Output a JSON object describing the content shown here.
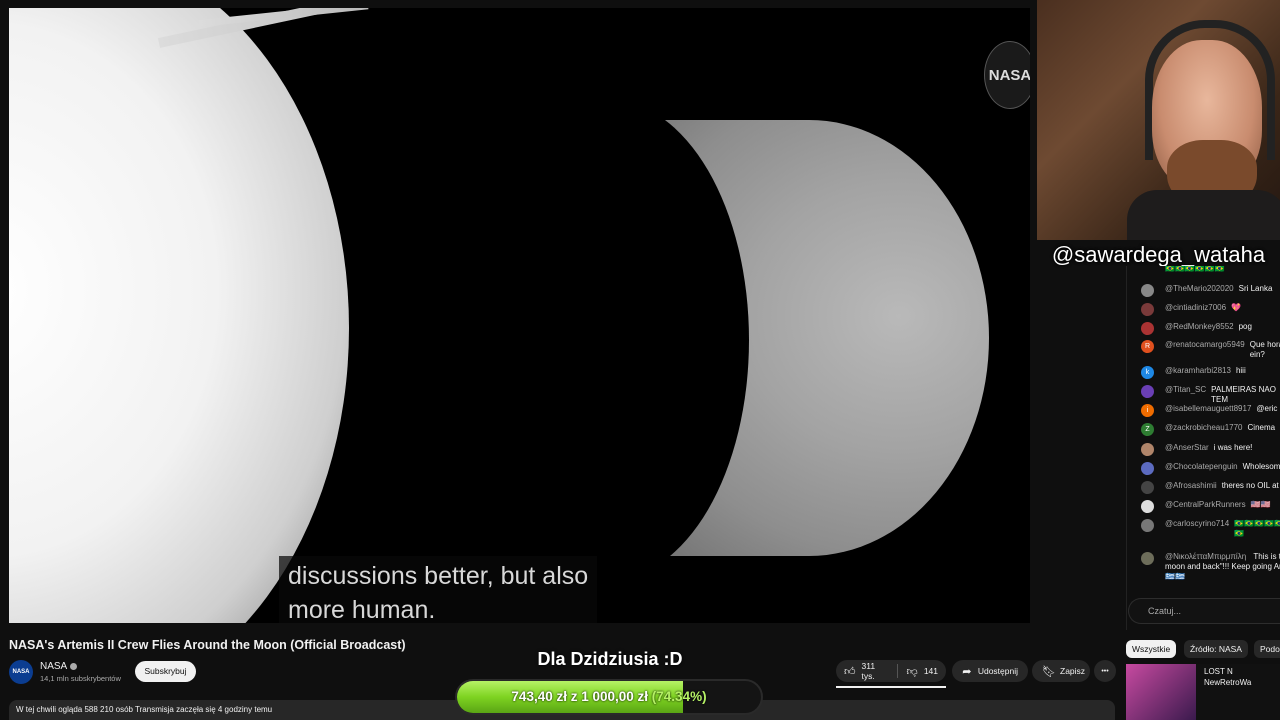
{
  "video": {
    "subtitle_line1": "discussions better, but also",
    "subtitle_line2": "more human.",
    "watermark": "NASA"
  },
  "webcam": {
    "handle": "@sawardega_wataha"
  },
  "chat": {
    "top_emojis": "🇧🇷🇧🇷🇧🇷🇧🇷🇧🇷🇧🇷",
    "messages": [
      {
        "author": "@TheMario202020",
        "text": "Sri Lanka",
        "avatar_color": "#888",
        "avatar_letter": ""
      },
      {
        "author": "@cintiadiniz7006",
        "text": "💖",
        "avatar_color": "#7a3a3a",
        "avatar_letter": ""
      },
      {
        "author": "@RedMonkey8552",
        "text": "pog",
        "avatar_color": "#a33",
        "avatar_letter": ""
      },
      {
        "author": "@renatocamargo5949",
        "text": "Que hora ein?",
        "avatar_color": "#e0501e",
        "avatar_letter": "R"
      },
      {
        "author": "@karamharbi2813",
        "text": "hiii",
        "avatar_color": "#1e88e5",
        "avatar_letter": "k"
      },
      {
        "author": "@Titan_SC",
        "text": "PALMEIRAS NAO TEM",
        "avatar_color": "#6a3fb5",
        "avatar_letter": ""
      },
      {
        "author": "@isabellemauguett8917",
        "text": "@eric",
        "avatar_color": "#ef6c00",
        "avatar_letter": "i"
      },
      {
        "author": "@zackrobicheau1770",
        "text": "Cinema",
        "avatar_color": "#2e7d32",
        "avatar_letter": "Z"
      },
      {
        "author": "@AnserStar",
        "text": "i was here!",
        "avatar_color": "#b0856a",
        "avatar_letter": ""
      },
      {
        "author": "@Chocolatepenguin",
        "text": "Wholesome",
        "avatar_color": "#5c6bc0",
        "avatar_letter": ""
      },
      {
        "author": "@Afrosashimii",
        "text": "theres no OIL at m",
        "avatar_color": "#444",
        "avatar_letter": ""
      },
      {
        "author": "@CentralParkRunners",
        "text": "🇺🇸🇺🇸",
        "avatar_color": "#ddd",
        "avatar_letter": ""
      },
      {
        "author": "@carloscyrino714",
        "text": "🇧🇷🇧🇷🇧🇷🇧🇷🇧🇷🇧🇷",
        "avatar_color": "#777",
        "avatar_letter": ""
      },
      {
        "author": "@ΝικολέτταΜπιρμπίλη",
        "text": "This is t moon and back\"!!! Keep going Art 🇬🇷🇬🇷",
        "avatar_color": "#6d6d5a",
        "avatar_letter": ""
      }
    ],
    "input_placeholder": "Czatuj..."
  },
  "below": {
    "title": "NASA's Artemis II Crew Flies Around the Moon (Official Broadcast)",
    "channel": "NASA",
    "avatar_text": "NASA",
    "subscribers": "14,1 mln subskrybentów",
    "subscribe_label": "Subskrybuj",
    "description": "W tej chwili ogląda 588 210 osób  Transmisja zaczęła się 4 godziny temu"
  },
  "actions": {
    "likes": "311 tys.",
    "dislikes": "141",
    "share": "Udostępnij",
    "save": "Zapisz",
    "more": "•••"
  },
  "donation": {
    "title": "Dla Dzidziusia :D",
    "amount_text": "743,40 zł  z  1 000,00 zł",
    "percent_text": "(74.34%)",
    "progress": 0.7434
  },
  "right_panel": {
    "chips": [
      "Wszystkie",
      "Źródło: NASA",
      "Podo"
    ],
    "thumb_title1": "LOST N",
    "thumb_title2": "NewRetroWa"
  },
  "colors": {
    "background": "#0f0f0f",
    "accent_green": "#7ed321"
  }
}
